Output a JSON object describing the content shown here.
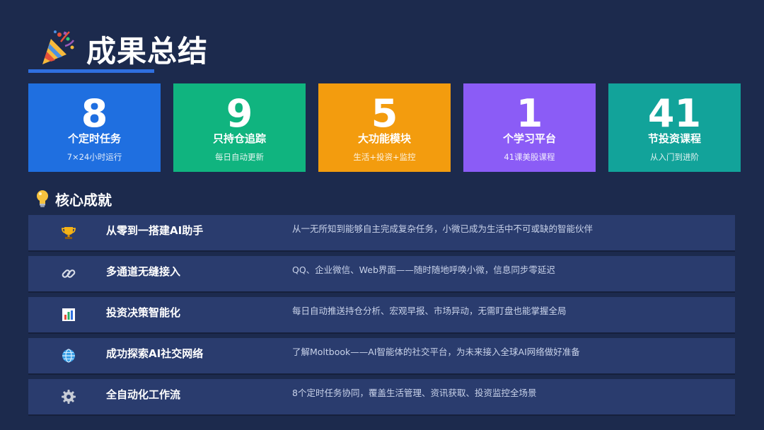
{
  "header": {
    "title": "成果总结",
    "icon": "party-popper-icon",
    "accent_color": "#2f6fe0"
  },
  "stats": [
    {
      "number": "8",
      "label": "个定时任务",
      "sub": "7×24小时运行",
      "color": "#1f6fe0"
    },
    {
      "number": "9",
      "label": "只持仓追踪",
      "sub": "每日自动更新",
      "color": "#10b47f"
    },
    {
      "number": "5",
      "label": "大功能模块",
      "sub": "生活+投资+监控",
      "color": "#f39c0e"
    },
    {
      "number": "1",
      "label": "个学习平台",
      "sub": "41课美股课程",
      "color": "#8b5cf6"
    },
    {
      "number": "41",
      "label": "节投资课程",
      "sub": "从入门到进阶",
      "color": "#12a39a"
    }
  ],
  "section": {
    "title": "核心成就",
    "icon": "lightbulb-icon"
  },
  "achievements": [
    {
      "icon": "trophy-icon",
      "title": "从零到一搭建AI助手",
      "desc": "从一无所知到能够自主完成复杂任务，小微已成为生活中不可或缺的智能伙伴"
    },
    {
      "icon": "link-icon",
      "title": "多通道无缝接入",
      "desc": "QQ、企业微信、Web界面——随时随地呼唤小微，信息同步零延迟"
    },
    {
      "icon": "bar-chart-icon",
      "title": "投资决策智能化",
      "desc": "每日自动推送持仓分析、宏观早报、市场异动，无需盯盘也能掌握全局"
    },
    {
      "icon": "globe-icon",
      "title": "成功探索AI社交网络",
      "desc": "了解Moltbook——AI智能体的社交平台，为未来接入全球AI网络做好准备"
    },
    {
      "icon": "gear-icon",
      "title": "全自动化工作流",
      "desc": "8个定时任务协同，覆盖生活管理、资讯获取、投资监控全场景"
    }
  ]
}
